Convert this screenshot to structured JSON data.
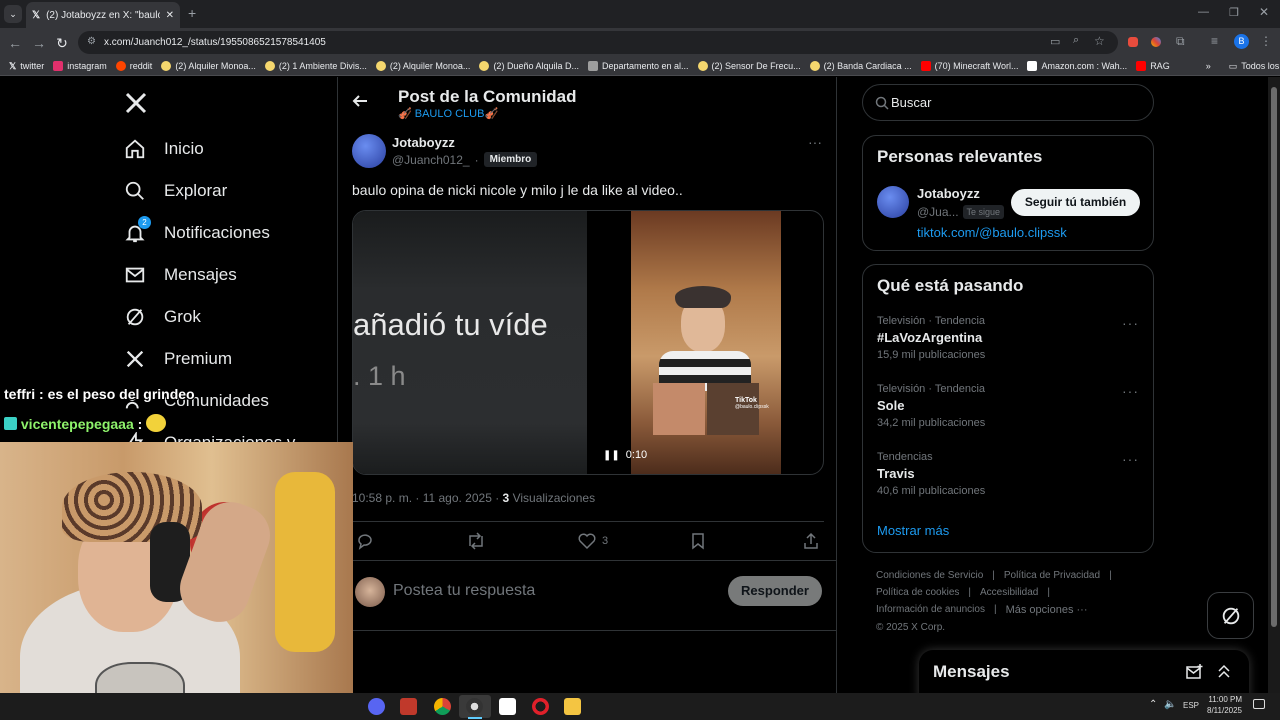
{
  "browser": {
    "tab_title": "(2) Jotaboyzz en X: \"baulo opin",
    "url": "x.com/Juanch012_/status/1955086521578541405",
    "bookmarks": [
      {
        "label": "twitter",
        "color": "#ffffff"
      },
      {
        "label": "instagram",
        "color": "#e1306c"
      },
      {
        "label": "reddit",
        "color": "#ff4500"
      },
      {
        "label": "(2) Alquiler Monoa...",
        "color": "#f5d76e"
      },
      {
        "label": "(2) 1 Ambiente Divis...",
        "color": "#f5d76e"
      },
      {
        "label": "(2) Alquiler Monoa...",
        "color": "#f5d76e"
      },
      {
        "label": "(2) Dueño Alquila D...",
        "color": "#f5d76e"
      },
      {
        "label": "Departamento en al...",
        "color": "#9e9e9e"
      },
      {
        "label": "(2) Sensor De Frecu...",
        "color": "#f5d76e"
      },
      {
        "label": "(2) Banda Cardiaca ...",
        "color": "#f5d76e"
      },
      {
        "label": "(70) Minecraft Worl...",
        "color": "#ff0000"
      },
      {
        "label": "Amazon.com : Wah...",
        "color": "#ffffff"
      },
      {
        "label": "RAG",
        "color": "#ff0000"
      }
    ],
    "bookmarks_more": "»",
    "all_bookmarks": "Todos los marcadores"
  },
  "sidebar": {
    "items": [
      {
        "label": "Inicio",
        "icon": "home-icon"
      },
      {
        "label": "Explorar",
        "icon": "search-icon"
      },
      {
        "label": "Notificaciones",
        "icon": "bell-icon",
        "badge": "2"
      },
      {
        "label": "Mensajes",
        "icon": "mail-icon"
      },
      {
        "label": "Grok",
        "icon": "grok-icon"
      },
      {
        "label": "Premium",
        "icon": "x-icon"
      },
      {
        "label": "Comunidades",
        "icon": "people-icon"
      },
      {
        "label": "Organizaciones v",
        "icon": "lightning-icon"
      }
    ]
  },
  "header": {
    "title": "Post de la Comunidad",
    "community": "🎻 BAULO CLUB🎻"
  },
  "post": {
    "author_name": "Jotaboyzz",
    "author_handle": "@Juanch012_",
    "dot": "·",
    "member_badge": "Miembro",
    "text": "baulo opina de nicki nicole y milo j le da like al video..",
    "video_left_text": "añadió tu víde",
    "video_left_sub": ". 1 h",
    "video_time": "0:10",
    "tiktok_label": "TikTok",
    "tiktok_handle": "@baulo.clipssk",
    "timestamp": "10:58 p. m. · 11 ago. 2025 · ",
    "views_count": "3",
    "views_label": "Visualizaciones",
    "likes": "3",
    "reply_placeholder": "Postea tu respuesta",
    "reply_button": "Responder"
  },
  "search": {
    "placeholder": "Buscar"
  },
  "relevant": {
    "title": "Personas relevantes",
    "name": "Jotaboyzz",
    "handle": "@Jua...",
    "follows_you": "Te sigue",
    "follow_button": "Seguir tú también",
    "link": "tiktok.com/@baulo.clipssk"
  },
  "trends": {
    "title": "Qué está pasando",
    "items": [
      {
        "category": "Televisión · Tendencia",
        "name": "#LaVozArgentina",
        "count": "15,9 mil publicaciones"
      },
      {
        "category": "Televisión · Tendencia",
        "name": "Sole",
        "count": "34,2 mil publicaciones"
      },
      {
        "category": "Tendencias",
        "name": "Travis",
        "count": "40,6 mil publicaciones"
      }
    ],
    "show_more": "Mostrar más"
  },
  "footer": {
    "links": [
      "Condiciones de Servicio",
      "|",
      "Política de Privacidad",
      "|",
      "Política de cookies",
      "|",
      "Accesibilidad",
      "|",
      "Información de anuncios",
      "|",
      "Más opciones ···"
    ],
    "copyright": "© 2025 X Corp."
  },
  "messages_drawer": {
    "title": "Mensajes"
  },
  "chat": {
    "line1_user": "teffri",
    "line1_text": ": es el peso del grindeo",
    "line2_user": "vicentepepegaaa",
    "line2_text": ":"
  },
  "taskbar": {
    "language": "ESP",
    "time": "11:00 PM",
    "date": "8/11/2025"
  },
  "colors": {
    "accent": "#1d9bf0",
    "x_background": "#000000",
    "border": "#2f3336",
    "muted": "#71767b",
    "chat_user2": "#8ef26b"
  }
}
